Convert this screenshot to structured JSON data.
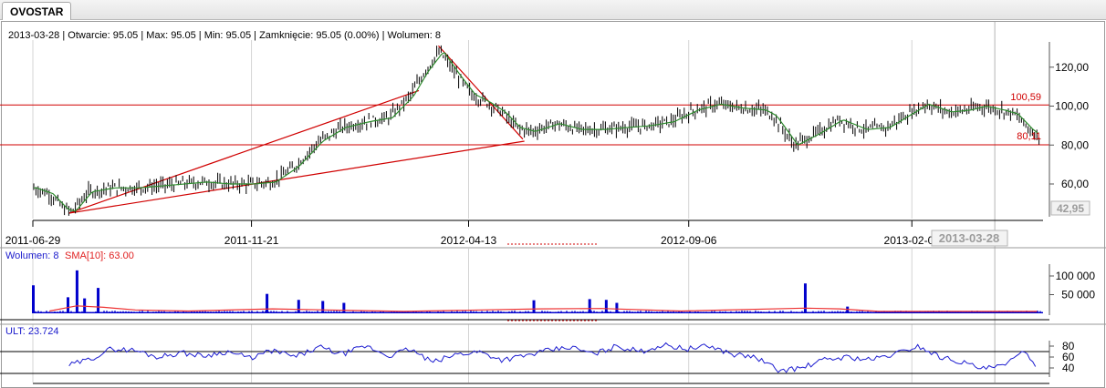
{
  "tab": {
    "label": "OVOSTAR"
  },
  "info": {
    "date": "2013-03-28",
    "open": "Otwarcie: 95.05",
    "max": "Max: 95.05",
    "min": "Min: 95.05",
    "close": "Zamknięcie: 95.05 (0.00%)",
    "volume": "Wolumen: 8"
  },
  "colors": {
    "candles": "#000000",
    "sma": "#2e8b2e",
    "support_lines": "#d00000",
    "volume_bars": "#0000cc",
    "volume_sma": "#ee3333",
    "ult": "#1c1cd0",
    "grid": "#d4d4d4"
  },
  "chart_data": [
    {
      "type": "line",
      "panel": "price",
      "x_tick_labels": [
        "2011-06-29",
        "2011-11-21",
        "2012-04-13",
        "2012-09-06",
        "2013-02-01"
      ],
      "cursor_date_label": "2013-03-28",
      "y_ticks": [
        60,
        80,
        100,
        120
      ],
      "y_tick_labels": [
        "60,00",
        "80,00",
        "100,00",
        "120,00"
      ],
      "ylim": [
        44,
        132
      ],
      "last_value_label": "42,95",
      "horizontal_lines": [
        {
          "value": 100.59,
          "label": "100,59"
        },
        {
          "value": 80.11,
          "label": "80,11"
        }
      ],
      "trendlines": [
        {
          "from": [
            "2011-07-23",
            45
          ],
          "to": [
            "2012-03-11",
            108
          ]
        },
        {
          "from": [
            "2011-07-23",
            45
          ],
          "to": [
            "2012-05-20",
            82
          ]
        },
        {
          "from": [
            "2012-03-24",
            131
          ],
          "to": [
            "2012-05-19",
            83
          ]
        }
      ],
      "series": [
        {
          "x": [
            "2011-06-29",
            "2011-07-10",
            "2011-07-20",
            "2011-07-25",
            "2011-08-05",
            "2011-08-20",
            "2011-09-05",
            "2011-09-20",
            "2011-10-05",
            "2011-10-20",
            "2011-11-05",
            "2011-11-20",
            "2011-12-05",
            "2011-12-20",
            "2012-01-05",
            "2012-01-20",
            "2012-02-05",
            "2012-02-20",
            "2012-03-05",
            "2012-03-15",
            "2012-03-25",
            "2012-04-05",
            "2012-04-15",
            "2012-04-25",
            "2012-05-05",
            "2012-05-15",
            "2012-05-25",
            "2012-06-10",
            "2012-06-25",
            "2012-07-10",
            "2012-07-25",
            "2012-08-10",
            "2012-08-25",
            "2012-09-10",
            "2012-09-25",
            "2012-10-10",
            "2012-10-25",
            "2012-11-01",
            "2012-11-15",
            "2012-11-30",
            "2012-12-15",
            "2012-12-31",
            "2013-01-15",
            "2013-01-30",
            "2013-02-10",
            "2013-02-25",
            "2013-03-10",
            "2013-03-20",
            "2013-04-01",
            "2013-04-10",
            "2013-04-20",
            "2013-04-25"
          ],
          "values": [
            58,
            55,
            47,
            46,
            56,
            58,
            58,
            59,
            60,
            61,
            60,
            60,
            61,
            69,
            82,
            89,
            92,
            94,
            105,
            118,
            128,
            116,
            106,
            102,
            97,
            89,
            87,
            91,
            88,
            88,
            89,
            90,
            92,
            98,
            101,
            99,
            98,
            95,
            80,
            86,
            93,
            88,
            89,
            96,
            101,
            97,
            98,
            100,
            98,
            96,
            88,
            85
          ]
        }
      ]
    },
    {
      "type": "bar",
      "panel": "volume",
      "title": "Wolumen: 8",
      "sma_label": "SMA[10]: 63.00",
      "y_ticks": [
        50000,
        100000
      ],
      "y_tick_labels": [
        "50 000",
        "100 000"
      ],
      "ylim": [
        0,
        130000
      ],
      "spikes": [
        {
          "x": "2011-06-29",
          "value": 75000
        },
        {
          "x": "2011-07-28",
          "value": 115000
        },
        {
          "x": "2011-08-11",
          "value": 68000
        },
        {
          "x": "2011-07-22",
          "value": 43000
        },
        {
          "x": "2011-08-02",
          "value": 40000
        },
        {
          "x": "2011-12-01",
          "value": 52000
        },
        {
          "x": "2011-12-22",
          "value": 36000
        },
        {
          "x": "2012-01-07",
          "value": 33000
        },
        {
          "x": "2012-01-21",
          "value": 28000
        },
        {
          "x": "2012-05-26",
          "value": 35000
        },
        {
          "x": "2012-07-02",
          "value": 38000
        },
        {
          "x": "2012-07-13",
          "value": 36000
        },
        {
          "x": "2012-07-20",
          "value": 28000
        },
        {
          "x": "2012-11-22",
          "value": 80000
        },
        {
          "x": "2012-12-20",
          "value": 18000
        }
      ]
    },
    {
      "type": "line",
      "panel": "oscillator",
      "title": "ULT: 23.724",
      "y_ticks": [
        40,
        60,
        80
      ],
      "y_tick_labels": [
        "40",
        "60",
        "80"
      ],
      "reference_lines": [
        30,
        70
      ],
      "ylim": [
        20,
        95
      ],
      "series": [
        {
          "x": [
            "2011-07-23",
            "2011-08-05",
            "2011-08-20",
            "2011-09-05",
            "2011-09-20",
            "2011-10-05",
            "2011-10-20",
            "2011-11-05",
            "2011-11-20",
            "2011-12-05",
            "2011-12-20",
            "2012-01-05",
            "2012-01-20",
            "2012-02-05",
            "2012-02-20",
            "2012-03-05",
            "2012-03-20",
            "2012-04-05",
            "2012-04-20",
            "2012-05-05",
            "2012-05-20",
            "2012-06-05",
            "2012-06-20",
            "2012-07-05",
            "2012-07-20",
            "2012-08-05",
            "2012-08-20",
            "2012-09-05",
            "2012-09-20",
            "2012-10-05",
            "2012-10-20",
            "2012-11-05",
            "2012-11-20",
            "2012-12-05",
            "2012-12-20",
            "2013-01-05",
            "2013-01-20",
            "2013-02-05",
            "2013-02-20",
            "2013-03-05",
            "2013-03-20",
            "2013-04-05",
            "2013-04-15",
            "2013-04-25"
          ],
          "values": [
            45,
            55,
            75,
            72,
            60,
            68,
            62,
            70,
            58,
            72,
            60,
            78,
            65,
            80,
            62,
            75,
            50,
            65,
            70,
            55,
            62,
            72,
            78,
            65,
            80,
            70,
            82,
            75,
            80,
            65,
            60,
            35,
            40,
            55,
            60,
            55,
            65,
            80,
            60,
            52,
            38,
            45,
            75,
            35
          ]
        }
      ]
    }
  ]
}
